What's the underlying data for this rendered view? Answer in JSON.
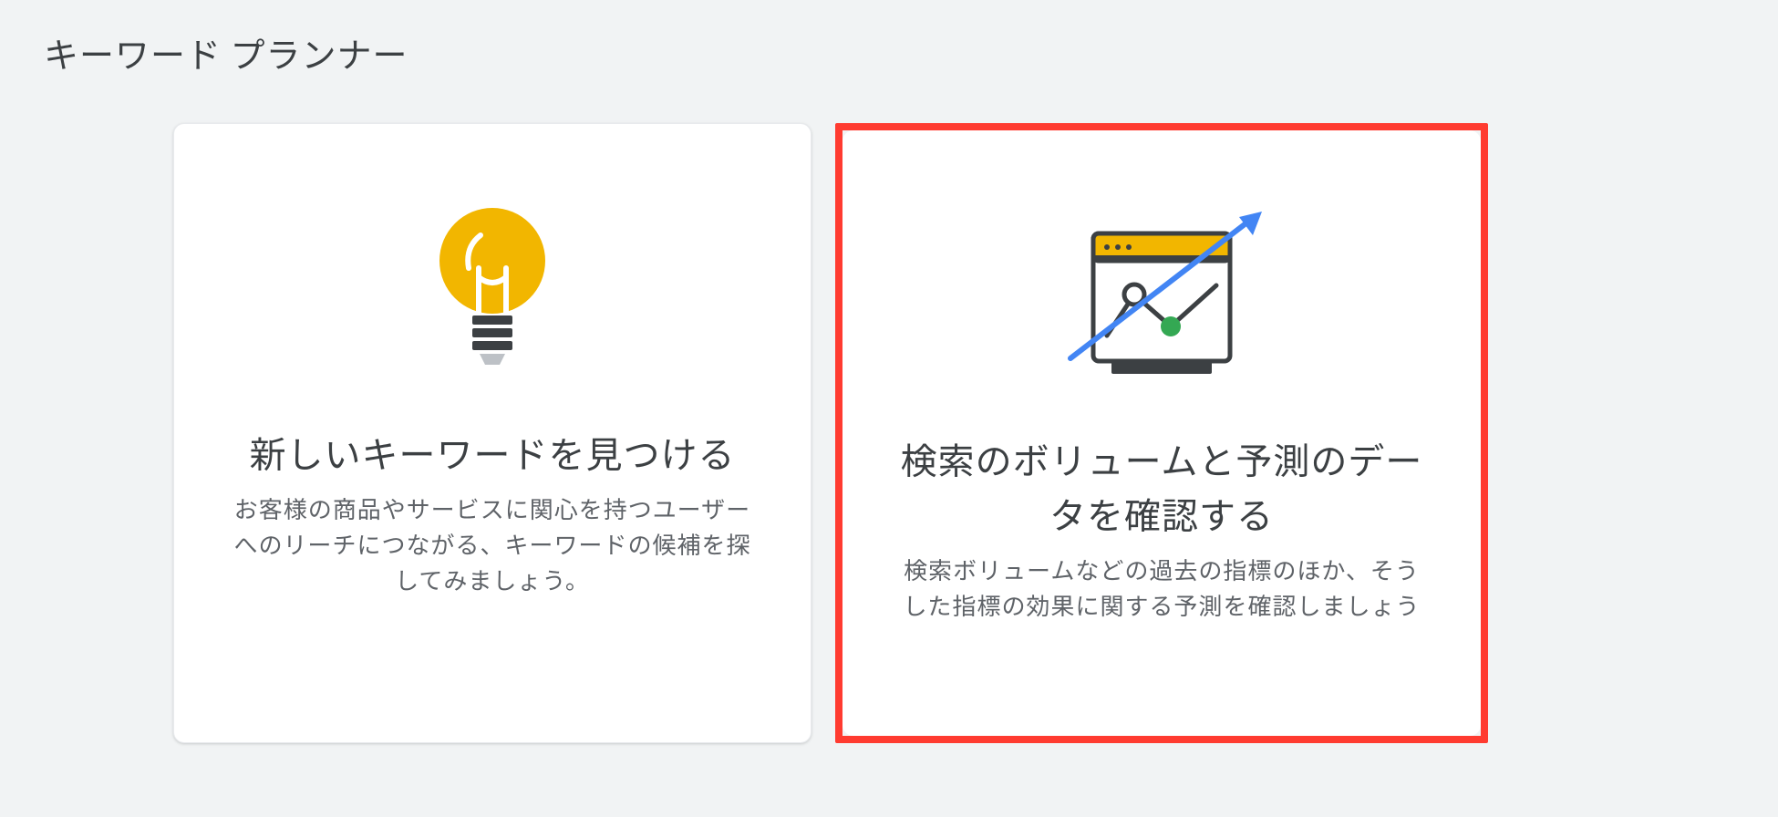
{
  "page": {
    "title": "キーワード プランナー"
  },
  "cards": {
    "discover": {
      "title": "新しいキーワードを見つける",
      "description": "お客様の商品やサービスに関心を持つユーザーへのリーチにつながる、キーワードの候補を探してみましょう。"
    },
    "forecast": {
      "title": "検索のボリュームと予測のデータを確認する",
      "description": "検索ボリュームなどの過去の指標のほか、そうした指標の効果に関する予測を確認しましょう"
    }
  }
}
